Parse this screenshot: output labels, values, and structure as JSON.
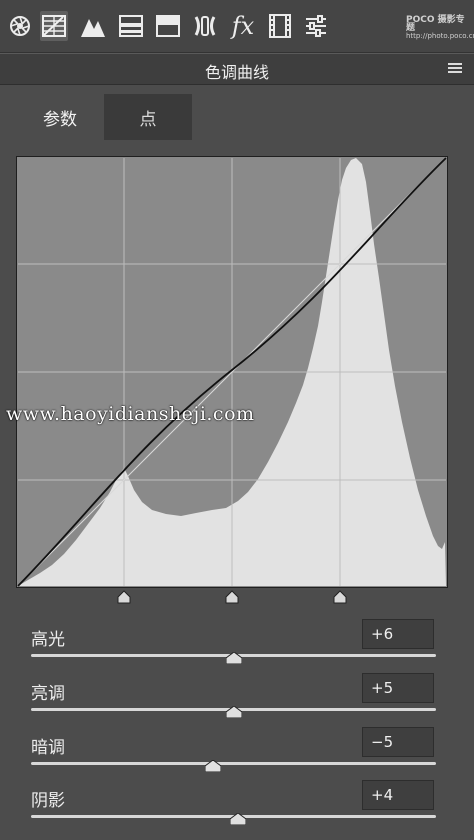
{
  "toolbar": {
    "tools": [
      {
        "id": "basic-icon",
        "active": false
      },
      {
        "id": "tone-curve-icon",
        "active": true
      },
      {
        "id": "detail-icon",
        "active": false
      },
      {
        "id": "hsl-icon",
        "active": false
      },
      {
        "id": "split-toning-icon",
        "active": false
      },
      {
        "id": "lens-corrections-icon",
        "active": false
      },
      {
        "id": "fx-icon",
        "active": false
      },
      {
        "id": "camera-calibration-icon",
        "active": false
      },
      {
        "id": "presets-icon",
        "active": false
      }
    ],
    "fx_label": "fx",
    "watermark_line1": "POCO 摄影专题",
    "watermark_line2": "http://photo.poco.cn/"
  },
  "panel": {
    "title": "色调曲线"
  },
  "tabs": {
    "params": "参数",
    "point": "点"
  },
  "watermark": {
    "url": "www.haoyidiansheji.com"
  },
  "curve": {
    "region_splits": [
      0.25,
      0.5,
      0.75
    ]
  },
  "sliders": [
    {
      "label": "高光",
      "value": "+6",
      "position": 0.5
    },
    {
      "label": "亮调",
      "value": "+5",
      "position": 0.5
    },
    {
      "label": "暗调",
      "value": "−5",
      "position": 0.45
    },
    {
      "label": "阴影",
      "value": "+4",
      "position": 0.51
    }
  ],
  "colors": {
    "panel_bg": "#4c4c4c",
    "curve_bg": "#8a8a8a",
    "histogram": "#e2e2e2",
    "grid": "#bdbdbd"
  }
}
